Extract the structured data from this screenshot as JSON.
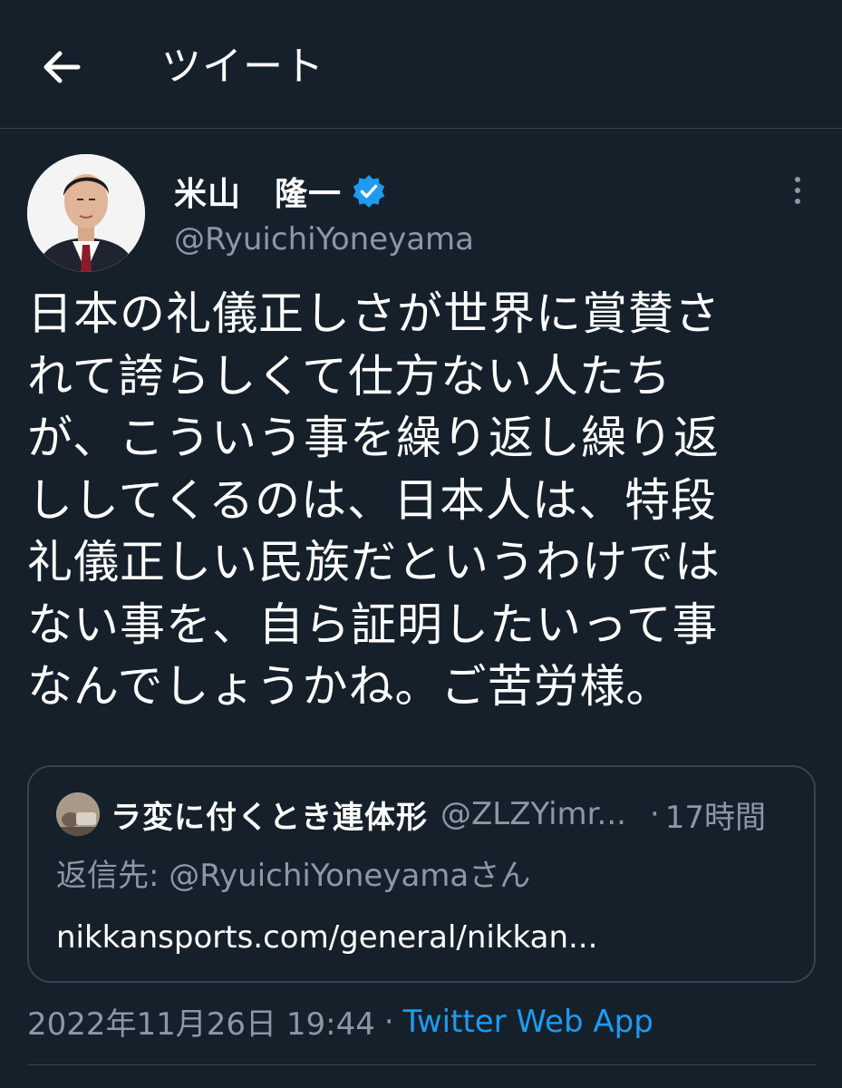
{
  "header": {
    "title": "ツイート",
    "back_icon": "arrow-left-icon"
  },
  "tweet": {
    "display_name": "米山　隆一",
    "handle": "@RyuichiYoneyama",
    "verified": true,
    "text_lines": [
      "日本の礼儀正しさが世界に賞賛さ",
      "れて誇らしくて仕方ない人たち",
      "が、こういう事を繰り返し繰り返",
      "ししてくるのは、日本人は、特段",
      "礼儀正しい民族だというわけでは",
      "ない事を、自ら証明したいって事",
      "なんでしょうかね。ご苦労様。"
    ],
    "timestamp": "2022年11月26日 19:44",
    "separator": "·",
    "source": "Twitter Web App"
  },
  "quoted_tweet": {
    "display_name": "ラ変に付くとき連体形",
    "handle": "@ZLZYimr...",
    "separator": "·",
    "time": "17時間",
    "reply_to": "返信先: @RyuichiYoneyamaさん",
    "link": "nikkansports.com/general/nikkan..."
  },
  "colors": {
    "background": "#15202b",
    "divider": "#38444d",
    "secondary_text": "#8b98a5",
    "accent": "#1d9bf0"
  }
}
